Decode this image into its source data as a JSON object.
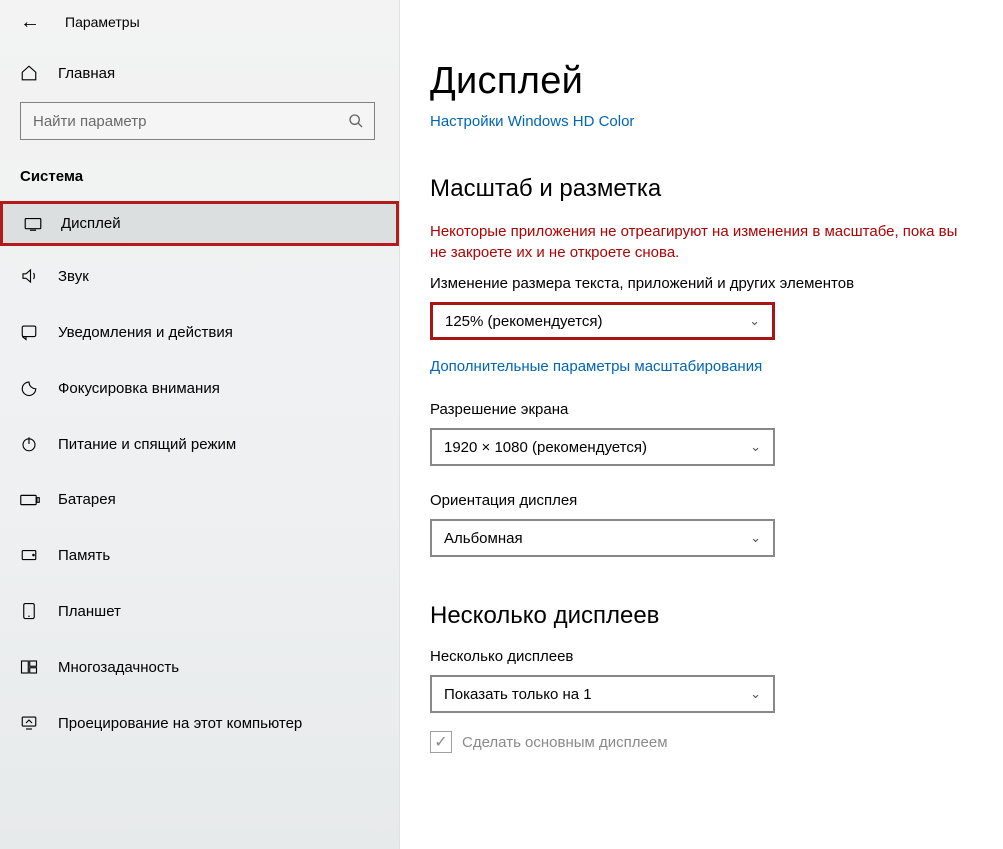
{
  "header": {
    "window_title": "Параметры"
  },
  "sidebar": {
    "home": "Главная",
    "search_placeholder": "Найти параметр",
    "section": "Система",
    "items": [
      {
        "icon": "display-icon",
        "label": "Дисплей"
      },
      {
        "icon": "sound-icon",
        "label": "Звук"
      },
      {
        "icon": "notification-icon",
        "label": "Уведомления и действия"
      },
      {
        "icon": "focus-icon",
        "label": "Фокусировка внимания"
      },
      {
        "icon": "power-icon",
        "label": "Питание и спящий режим"
      },
      {
        "icon": "battery-icon",
        "label": "Батарея"
      },
      {
        "icon": "storage-icon",
        "label": "Память"
      },
      {
        "icon": "tablet-icon",
        "label": "Планшет"
      },
      {
        "icon": "multitask-icon",
        "label": "Многозадачность"
      },
      {
        "icon": "project-icon",
        "label": "Проецирование на этот компьютер"
      }
    ]
  },
  "main": {
    "title": "Дисплей",
    "hd_color_link": "Настройки Windows HD Color",
    "scale_section": "Масштаб и разметка",
    "scale_warning": "Некоторые приложения не отреагируют на изменения в масштабе, пока вы не закроете их и не откроете снова.",
    "scale_label": "Изменение размера текста, приложений и других элементов",
    "scale_value": "125% (рекомендуется)",
    "advanced_scale_link": "Дополнительные параметры масштабирования",
    "resolution_label": "Разрешение экрана",
    "resolution_value": "1920 × 1080 (рекомендуется)",
    "orientation_label": "Ориентация дисплея",
    "orientation_value": "Альбомная",
    "multi_section": "Несколько дисплеев",
    "multi_label": "Несколько дисплеев",
    "multi_value": "Показать только на 1",
    "make_primary": "Сделать основным дисплеем"
  }
}
